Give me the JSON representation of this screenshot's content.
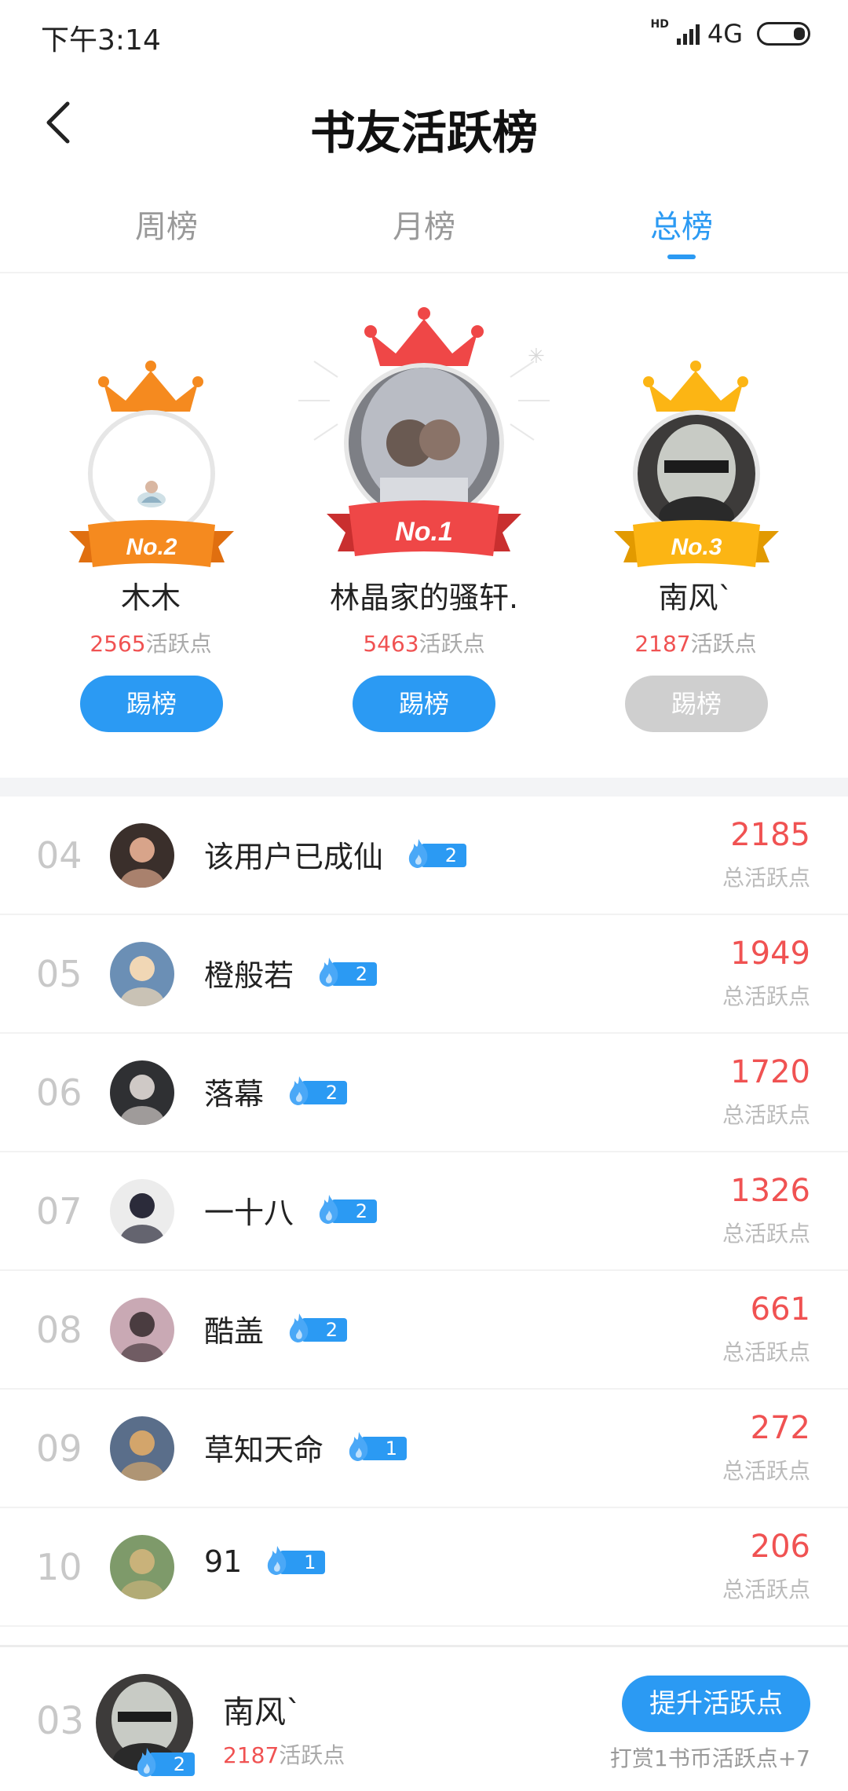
{
  "status_bar": {
    "time": "下午3:14",
    "network": "4G",
    "hd": "HD"
  },
  "header": {
    "title": "书友活跃榜"
  },
  "tabs": [
    {
      "label": "周榜",
      "active": false
    },
    {
      "label": "月榜",
      "active": false
    },
    {
      "label": "总榜",
      "active": true
    }
  ],
  "podium": {
    "first": {
      "badge": "No.1",
      "name": "林晶家的骚轩.",
      "points": "5463",
      "points_suffix": "活跃点",
      "button": "踢榜",
      "button_enabled": true,
      "color": "#ef4747"
    },
    "second": {
      "badge": "No.2",
      "name": "木木",
      "points": "2565",
      "points_suffix": "活跃点",
      "button": "踢榜",
      "button_enabled": true,
      "color": "#f58a1f"
    },
    "third": {
      "badge": "No.3",
      "name": "南风`",
      "points": "2187",
      "points_suffix": "活跃点",
      "button": "踢榜",
      "button_enabled": false,
      "color": "#fcb514"
    }
  },
  "list": {
    "score_label": "总活跃点",
    "rows": [
      {
        "rank": "04",
        "name": "该用户已成仙",
        "level": "2",
        "score": "2185"
      },
      {
        "rank": "05",
        "name": "橙般若",
        "level": "2",
        "score": "1949"
      },
      {
        "rank": "06",
        "name": "落幕",
        "level": "2",
        "score": "1720"
      },
      {
        "rank": "07",
        "name": "一十八",
        "level": "2",
        "score": "1326"
      },
      {
        "rank": "08",
        "name": "酷盖",
        "level": "2",
        "score": "661"
      },
      {
        "rank": "09",
        "name": "草知天命",
        "level": "1",
        "score": "272"
      },
      {
        "rank": "10",
        "name": "91",
        "level": "1",
        "score": "206"
      }
    ]
  },
  "my_rank": {
    "rank": "03",
    "name": "南风`",
    "level": "2",
    "points": "2187",
    "points_suffix": "活跃点",
    "button": "提升活跃点",
    "hint": "打赏1书币活跃点+7"
  },
  "colors": {
    "accent": "#2b9af3",
    "score": "#f05252",
    "muted": "#999999"
  }
}
